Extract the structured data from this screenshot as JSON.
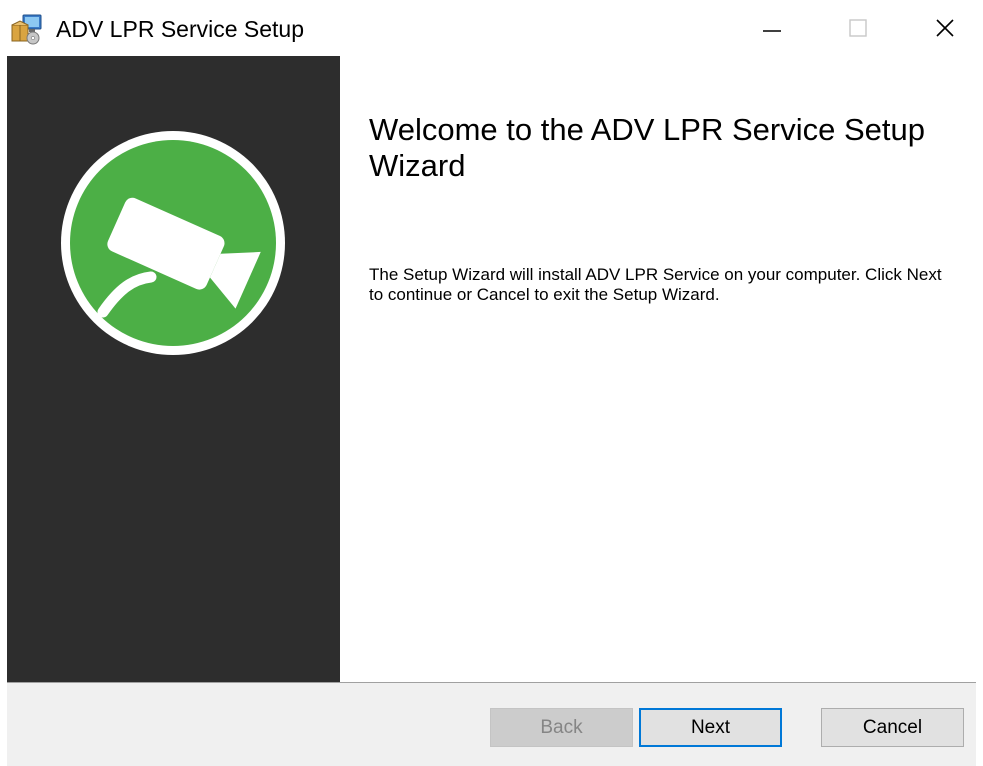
{
  "window": {
    "title": "ADV LPR Service Setup",
    "icon": "installer-package-icon",
    "controls": {
      "minimize_icon": "minimize-icon",
      "maximize_icon": "maximize-icon",
      "close_icon": "close-icon"
    }
  },
  "banner": {
    "background_color": "#2d2d2d",
    "logo_icon": "security-camera-icon",
    "logo_color": "#4caf46"
  },
  "content": {
    "heading": "Welcome to the ADV LPR Service Setup Wizard",
    "description": "The Setup Wizard will install ADV LPR Service on your computer. Click Next to continue or Cancel to exit the Setup Wizard."
  },
  "footer": {
    "back_label": "Back",
    "back_enabled": false,
    "next_label": "Next",
    "cancel_label": "Cancel",
    "focus_color": "#0078d7"
  }
}
